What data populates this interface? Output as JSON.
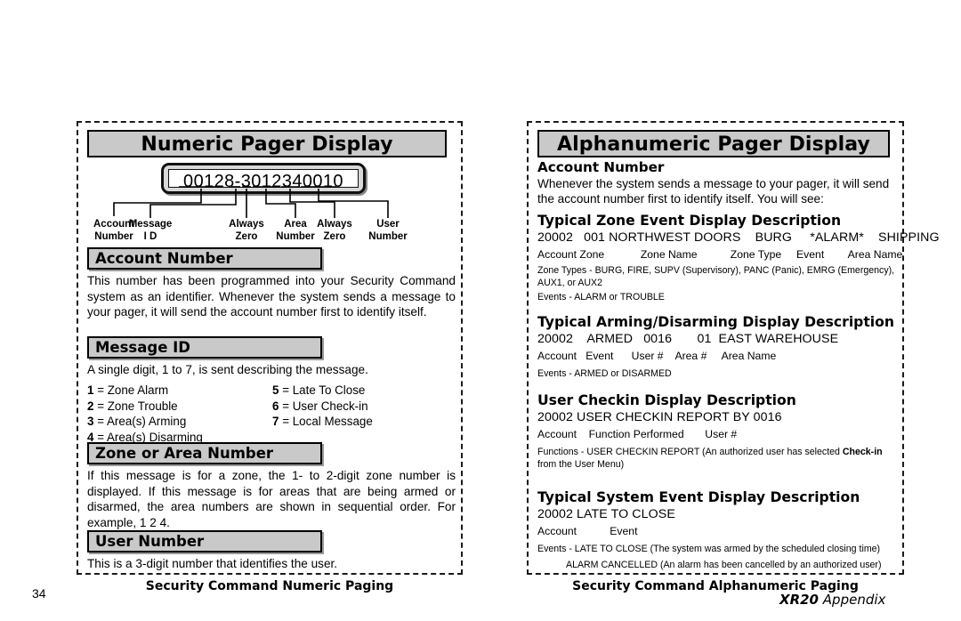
{
  "document": {
    "page_number": "34",
    "doc_ref_bold": "XR20",
    "doc_ref_italic": "Appendix"
  },
  "numeric_panel": {
    "title": "Numeric Pager Display",
    "pager_display_value": "00128-3012340010",
    "callouts": [
      {
        "line1": "Account",
        "line2": "Number"
      },
      {
        "line1": "Message",
        "line2": "I D"
      },
      {
        "line1": "Always",
        "line2": "Zero"
      },
      {
        "line1": "Area",
        "line2": "Number"
      },
      {
        "line1": "Always",
        "line2": "Zero"
      },
      {
        "line1": "User",
        "line2": "Number"
      }
    ],
    "sections": [
      {
        "heading": "Account Number",
        "body": "This number has been programmed into your Security Command system as an identifier.  Whenever the system sends a message to your pager, it will send the account number first to identify itself."
      },
      {
        "heading": "Message ID",
        "body": "A single digit, 1 to 7, is sent describing the message."
      },
      {
        "heading": "Zone or Area Number",
        "body": "If this message is for a zone, the 1- to 2-digit zone number is displayed.  If this message is for areas that are being armed or disarmed, the area numbers are shown in sequential order.  For example, 1 2 4."
      },
      {
        "heading": "User Number",
        "body": "This is a 3-digit number that identifies the user."
      }
    ],
    "message_id_list_left": [
      {
        "num": "1",
        "label": "= Zone Alarm"
      },
      {
        "num": "2",
        "label": "= Zone Trouble"
      },
      {
        "num": "3",
        "label": "= Area(s) Arming"
      },
      {
        "num": "4",
        "label": "= Area(s) Disarming"
      }
    ],
    "message_id_list_right": [
      {
        "num": "5",
        "label": "= Late To Close"
      },
      {
        "num": "6",
        "label": "= User Check-in"
      },
      {
        "num": "7",
        "label": "= Local Message"
      }
    ],
    "footer": "Security Command Numeric Paging"
  },
  "alpha_panel": {
    "title": "Alphanumeric Pager Display",
    "account_number_heading": "Account Number",
    "account_number_body": "Whenever the system sends a message to your pager, it will send the account number first to identify itself.  You will see:",
    "zone_event": {
      "heading": "Typical Zone Event Display Description",
      "example": "20002   001 NORTHWEST DOORS    BURG     *ALARM*    SHIPPING",
      "legend": "Account Zone            Zone Name           Zone Type     Event        Area Name",
      "note1": "Zone Types - BURG, FIRE, SUPV (Supervisory), PANC (Panic), EMRG (Emergency), AUX1, or AUX2",
      "note2": "Events - ALARM  or  TROUBLE"
    },
    "arming_event": {
      "heading": "Typical Arming/Disarming Display Description",
      "example": "20002    ARMED   0016       01  EAST WAREHOUSE",
      "legend": "Account   Event      User #    Area #     Area Name",
      "note1": "Events - ARMED  or  DISARMED"
    },
    "user_checkin": {
      "heading": "User Checkin Display Description",
      "example": "20002 USER CHECKIN REPORT BY 0016",
      "legend": "Account    Function Performed       User #",
      "note_prefix": "Functions - USER CHECKIN REPORT (An authorized user has selected ",
      "note_bold": "Check-in",
      "note_suffix": " from the User Menu)"
    },
    "system_event": {
      "heading": "Typical System Event Display Description",
      "example": "20002 LATE TO CLOSE",
      "legend": "Account           Event",
      "note1": "Events - LATE TO CLOSE (The system was armed by the scheduled closing time)",
      "note2": "ALARM CANCELLED (An alarm has been cancelled by an authorized user)"
    },
    "footer": "Security Command Alphanumeric Paging"
  }
}
